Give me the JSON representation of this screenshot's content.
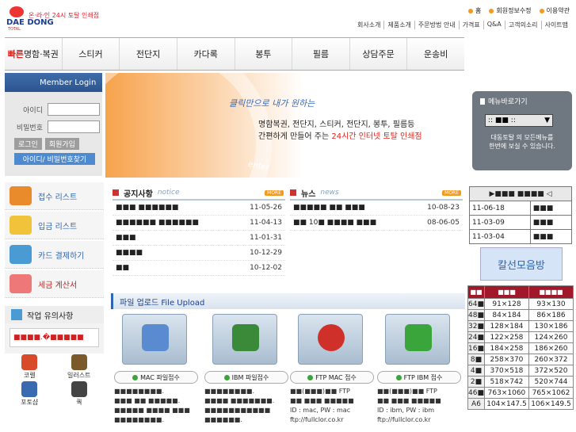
{
  "header": {
    "brand": "DAE DONG",
    "brand_sub": "TOTAL",
    "tagline": "온·라·인 24시 토탈 인쇄점",
    "top_links": [
      "홈",
      "회원정보수정",
      "이용약관"
    ],
    "sub_links": [
      "회사소개",
      "제품소개",
      "주문방법 안내",
      "가격표",
      "Q&A",
      "고객의소리",
      "사이트맵"
    ]
  },
  "nav": {
    "first_hl": "빠른",
    "first_rest": "명함·복권",
    "items": [
      "스티커",
      "전단지",
      "카다록",
      "봉투",
      "필름",
      "상담주문",
      "운송비"
    ]
  },
  "login": {
    "title": "Member Login",
    "id_label": "아이디",
    "pw_label": "비밀번호",
    "login_btn": "로그인",
    "join_btn": "회원가입",
    "find_btn": "아이디/ 비밀번호찾기"
  },
  "banner": {
    "line1": "클릭만으로 내가 원하는",
    "line2": "명함복권, 전단지, 스티커, 전단지, 봉투, 필름등",
    "line3a": "간편하게 만들어 주는",
    "line3b": "24시간 인터넷 토탈 인쇄점",
    "mark": "enter"
  },
  "quick": {
    "title": "메뉴바로가기",
    "select_value": ":: ■■ ::",
    "desc1": "대동토탈 의 모든메뉴를",
    "desc2": "한번에 보실 수 있습니다."
  },
  "left_list": [
    {
      "label": "접수 리스트",
      "color": "#e98b2a"
    },
    {
      "label": "입금 리스트",
      "color": "#f1c33a"
    },
    {
      "label": "카드 결제하기",
      "color": "#4a9ad4"
    },
    {
      "label": "세금 계산서",
      "color": "#e77"
    }
  ],
  "warn": {
    "title": "작업 유의사항",
    "text": "■■■■.�■■■■■"
  },
  "apps": [
    {
      "label": "코렐",
      "color": "#d84a2a"
    },
    {
      "label": "일러스트",
      "color": "#7a5a2a"
    },
    {
      "label": "포토샵",
      "color": "#3a6ab0"
    },
    {
      "label": "쿽",
      "color": "#444"
    }
  ],
  "notice": {
    "title": "공지사항",
    "en": "notice",
    "more": "MORE",
    "items": [
      {
        "t": "■■■ ■■■■■■",
        "d": "11-05-26"
      },
      {
        "t": "■■■■■■ ■■■■■■",
        "d": "11-04-13"
      },
      {
        "t": "■■■",
        "d": "11-01-31"
      },
      {
        "t": "■■■■",
        "d": "10-12-29"
      },
      {
        "t": "■■",
        "d": "10-12-02"
      }
    ]
  },
  "news": {
    "title": "뉴스",
    "en": "news",
    "more": "MORE",
    "items": [
      {
        "t": "■■■■■ ■■ ■■■",
        "d": "10-08-23"
      },
      {
        "t": "■■ 10■ ■■■■ ■■■",
        "d": "08-06-05"
      }
    ]
  },
  "file_upload": {
    "title": "파일 업로드 File Upload",
    "cols": [
      {
        "btn": "MAC 파일접수",
        "logo": "#5a8ad0",
        "text": "■■■■■■■■.\n■■■ ■■ ■■■■■.\n■■■■■ ■■■■ ■■■\n■■■■■■■■."
      },
      {
        "btn": "IBM 파일접수",
        "logo": "#3a8a3a",
        "text": "■■■■■■■■.\n■■■■ ■■■■■■■.\n■■■■■■■■■■■\n■■■■■■."
      },
      {
        "btn": "FTP MAC 접수",
        "logo": "#d0302a",
        "text": "■■(■■■)■■ FTP\n■■ ■■■ ■■■■■\nID : mac, PW : mac\nftp://fullclor.co.kr"
      },
      {
        "btn": "FTP IBM 접수",
        "logo": "#3aa53a",
        "text": "■■(■■■)■■ FTP\n■■ ■■■ ■■■■■\nID : ibm, PW : ibm\nftp://fullclor.co.kr"
      }
    ]
  },
  "right_table1": {
    "header": "▶■■■ ■■■■ ◁",
    "rows": [
      {
        "date": "11-06-18",
        "v": "■■■"
      },
      {
        "date": "11-03-09",
        "v": "■■■"
      },
      {
        "date": "11-03-04",
        "v": "■■■"
      }
    ]
  },
  "ad": {
    "text": "칼선모음방"
  },
  "right_table2": {
    "headers": [
      "■■",
      "■■■",
      "■■■■"
    ],
    "rows": [
      [
        "64■",
        "91×128",
        "93×130"
      ],
      [
        "48■",
        "84×184",
        "86×186"
      ],
      [
        "32■",
        "128×184",
        "130×186"
      ],
      [
        "24■",
        "122×258",
        "124×260"
      ],
      [
        "16■",
        "184×258",
        "186×260"
      ],
      [
        "8■",
        "258×370",
        "260×372"
      ],
      [
        "4■",
        "370×518",
        "372×520"
      ],
      [
        "2■",
        "518×742",
        "520×744"
      ],
      [
        "46■",
        "763×1060",
        "765×1062"
      ],
      [
        "A6",
        "104×147.5",
        "106×149.5"
      ]
    ]
  }
}
